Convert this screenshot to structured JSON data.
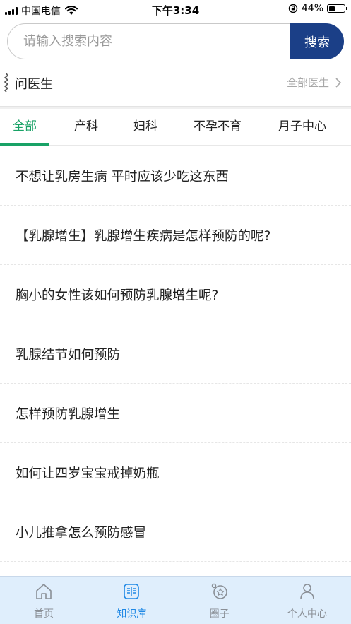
{
  "status_bar": {
    "carrier": "中国电信",
    "time": "下午3:34",
    "battery_percent_label": "44%",
    "battery_level": 0.44
  },
  "search": {
    "placeholder": "请输入搜索内容",
    "button_label": "搜索"
  },
  "ask_doctor": {
    "title": "问医生",
    "all_link": "全部医生"
  },
  "tabs": [
    {
      "label": "全部",
      "active": true
    },
    {
      "label": "产科",
      "active": false
    },
    {
      "label": "妇科",
      "active": false
    },
    {
      "label": "不孕不育",
      "active": false
    },
    {
      "label": "月子中心",
      "active": false
    }
  ],
  "articles": [
    {
      "title": "不想让乳房生病 平时应该少吃这东西"
    },
    {
      "title": "【乳腺增生】乳腺增生疾病是怎样预防的呢?"
    },
    {
      "title": "胸小的女性该如何预防乳腺增生呢?"
    },
    {
      "title": "乳腺结节如何预防"
    },
    {
      "title": "怎样预防乳腺增生"
    },
    {
      "title": "如何让四岁宝宝戒掉奶瓶"
    },
    {
      "title": "小儿推拿怎么预防感冒"
    }
  ],
  "bottom_nav": [
    {
      "label": "首页",
      "icon": "home-icon",
      "active": false
    },
    {
      "label": "知识库",
      "icon": "book-icon",
      "active": true
    },
    {
      "label": "圈子",
      "icon": "circle-icon",
      "active": false
    },
    {
      "label": "个人中心",
      "icon": "person-icon",
      "active": false
    }
  ],
  "colors": {
    "search_button": "#1b3f87",
    "tab_active": "#18a266",
    "nav_active": "#1e88e5",
    "nav_background": "#dfeefc"
  }
}
